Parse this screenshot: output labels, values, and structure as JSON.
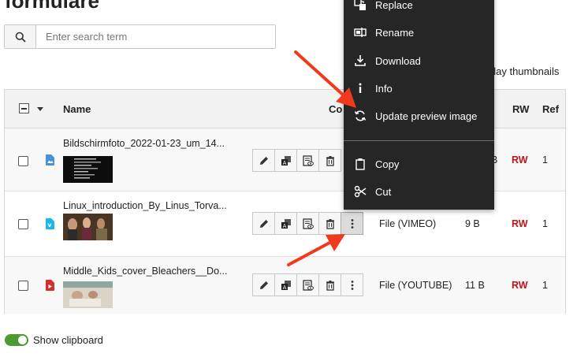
{
  "page": {
    "heading": "formulare"
  },
  "search": {
    "placeholder": "Enter search term",
    "icon": "search-icon"
  },
  "thumbnails_label": "play thumbnails",
  "table": {
    "headers": {
      "name": "Name",
      "control": "Co",
      "rw": "RW",
      "ref": "Ref"
    },
    "rows": [
      {
        "name": "Bildschirmfoto_2022-01-23_um_14...",
        "type": "",
        "size": "B",
        "rw": "RW",
        "ref": "1",
        "icon": "image-file-icon",
        "icon_color": "#4a90d9"
      },
      {
        "name": "Linux_introduction_By_Linus_Torva...",
        "type": "File (VIMEO)",
        "size": "9 B",
        "rw": "RW",
        "ref": "1",
        "icon": "vimeo-icon",
        "icon_color": "#1ab7ea"
      },
      {
        "name": "Middle_Kids_cover_Bleachers__Do...",
        "type": "File (YOUTUBE)",
        "size": "11 B",
        "rw": "RW",
        "ref": "1",
        "icon": "youtube-icon",
        "icon_color": "#d32f2f"
      }
    ]
  },
  "clipboard": {
    "label": "Show clipboard",
    "enabled": true
  },
  "context_menu": {
    "items": [
      {
        "label": "Replace",
        "icon": "replace-icon"
      },
      {
        "label": "Rename",
        "icon": "rename-icon"
      },
      {
        "label": "Download",
        "icon": "download-icon"
      },
      {
        "label": "Info",
        "icon": "info-icon"
      },
      {
        "label": "Update preview image",
        "icon": "refresh-icon"
      },
      {
        "label": "Copy",
        "icon": "copy-icon"
      },
      {
        "label": "Cut",
        "icon": "scissors-icon"
      }
    ]
  },
  "colors": {
    "rw": "#c0141c",
    "toggle": "#4c9a32",
    "menu_bg": "#262626",
    "arrow": "#f0391d"
  }
}
